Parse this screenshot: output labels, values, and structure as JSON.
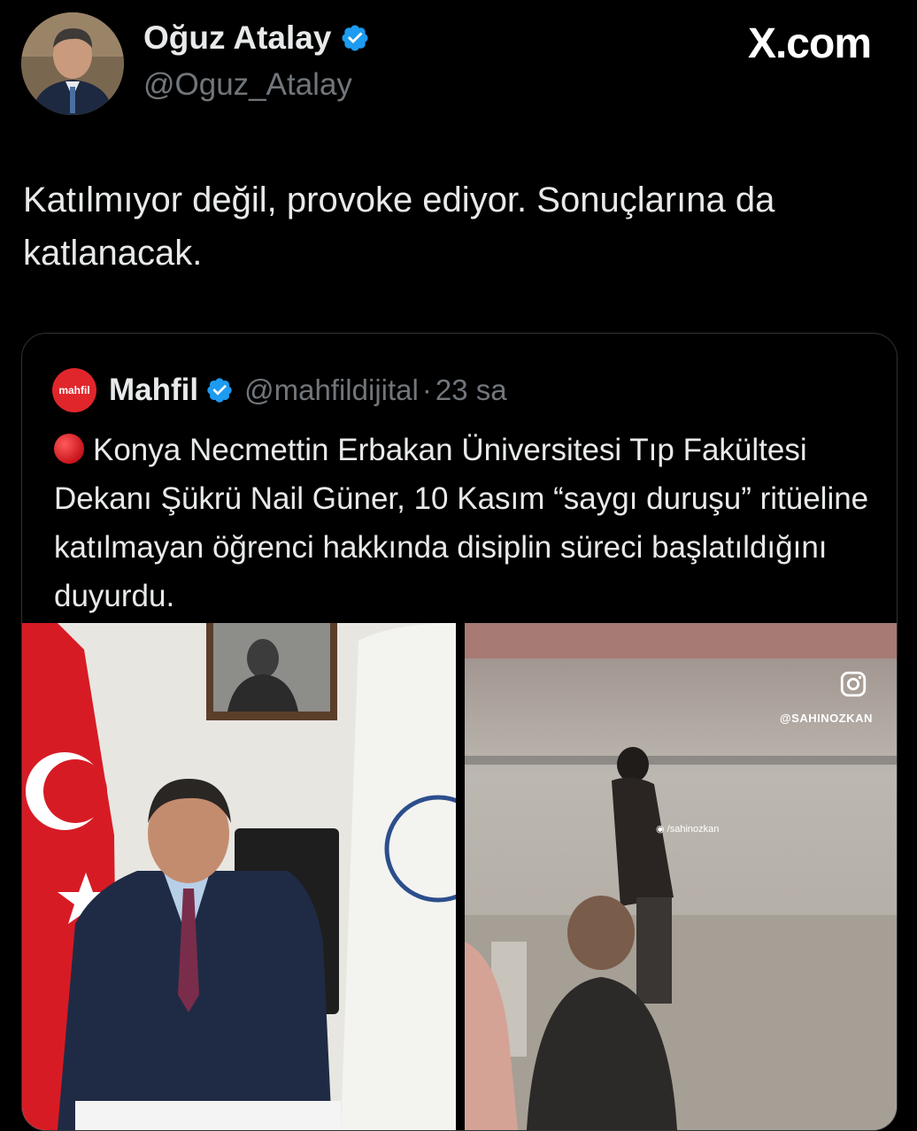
{
  "author": {
    "name": "Oğuz Atalay",
    "handle": "@Oguz_Atalay",
    "avatar_icon": "profile-photo"
  },
  "site_label": "X.com",
  "tweet": {
    "text": "Katılmıyor değil, provoke ediyor. Sonuçlarına da katlanacak."
  },
  "quote": {
    "logo_text": "mahfil",
    "name": "Mahfil",
    "handle": "@mahfildijital",
    "separator": "·",
    "time": "23 sa",
    "text": "Konya Necmettin Erbakan Üniversitesi Tıp Fakültesi Dekanı Şükrü Nail Güner, 10 Kasım “saygı duruşu” ritüeline katılmayan öğrenci hakkında disiplin süreci başlatıldığını duyurdu.",
    "media_right": {
      "watermark_handle": "@SAHINOZKAN",
      "overlay_handle": "/sahinozkan"
    }
  },
  "colors": {
    "background": "#000000",
    "verified_blue": "#1d9bf0",
    "muted_text": "#71767b",
    "mahfil_red": "#e0262b"
  }
}
